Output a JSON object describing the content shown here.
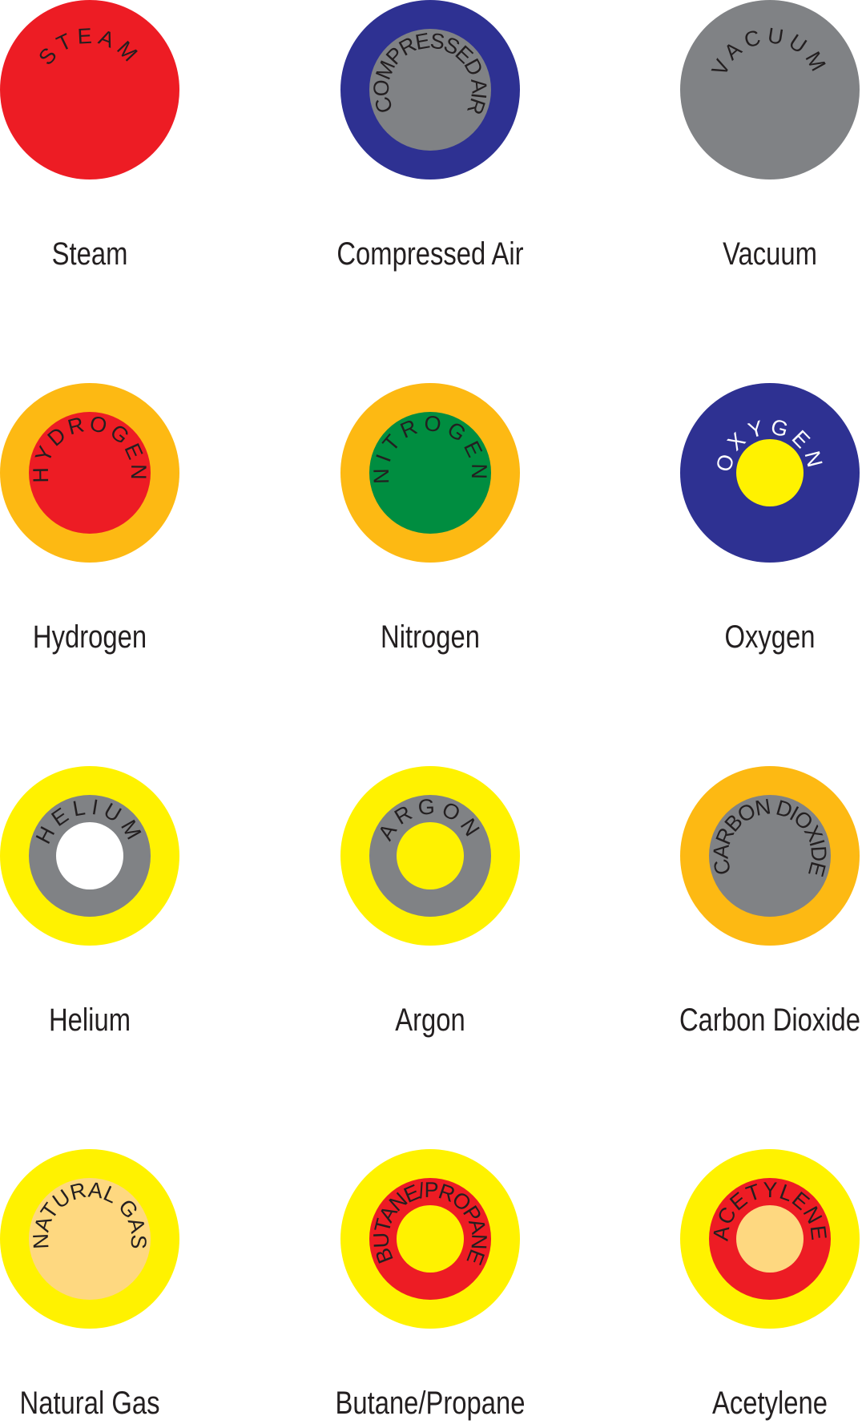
{
  "markers": [
    {
      "label": "Steam",
      "ring_text": "STEAM",
      "outer": "#ed1c24",
      "inner": null,
      "core": null,
      "text_color": "#231f20",
      "spacing": 6
    },
    {
      "label": "Compressed Air",
      "ring_text": "COMPRESSED AIR",
      "outer": "#2e3192",
      "inner": "#808285",
      "core": null,
      "text_color": "#231f20",
      "spacing": -2
    },
    {
      "label": "Vacuum",
      "ring_text": "VACUUM",
      "outer": "#808285",
      "inner": null,
      "core": null,
      "text_color": "#231f20",
      "spacing": 6
    },
    {
      "label": "Hydrogen",
      "ring_text": "HYDROGEN",
      "outer": "#fdb913",
      "inner": "#ed1c24",
      "core": null,
      "text_color": "#231f20",
      "spacing": 4
    },
    {
      "label": "Nitrogen",
      "ring_text": "NITROGEN",
      "outer": "#fdb913",
      "inner": "#008d40",
      "core": null,
      "text_color": "#231f20",
      "spacing": 6
    },
    {
      "label": "Oxygen",
      "ring_text": "OXYGEN",
      "outer": "#2e3192",
      "inner": null,
      "core": "#fff200",
      "text_color": "#ffffff",
      "spacing": 6
    },
    {
      "label": "Helium",
      "ring_text": "HELIUM",
      "outer": "#fff200",
      "inner": "#808285",
      "core": "#ffffff",
      "text_color": "#231f20",
      "spacing": 6
    },
    {
      "label": "Argon",
      "ring_text": "ARGON",
      "outer": "#fff200",
      "inner": "#808285",
      "core": "#fff200",
      "text_color": "#231f20",
      "spacing": 6
    },
    {
      "label": "Carbon Dioxide",
      "ring_text": "CARBON DIOXIDE",
      "outer": "#fdb913",
      "inner": "#808285",
      "core": null,
      "text_color": "#231f20",
      "spacing": -2
    },
    {
      "label": "Natural Gas",
      "ring_text": "NATURAL GAS",
      "outer": "#fff200",
      "inner": "#fed880",
      "core": null,
      "text_color": "#231f20",
      "spacing": 0
    },
    {
      "label": "Butane/Propane",
      "ring_text": "BUTANE/PROPANE",
      "outer": "#fff200",
      "inner": "#ed1c24",
      "core": "#fff200",
      "text_color": "#231f20",
      "spacing": -2
    },
    {
      "label": "Acetylene",
      "ring_text": "ACETYLENE",
      "outer": "#fff200",
      "inner": "#ed1c24",
      "core": "#fed880",
      "text_color": "#231f20",
      "spacing": 1
    }
  ]
}
